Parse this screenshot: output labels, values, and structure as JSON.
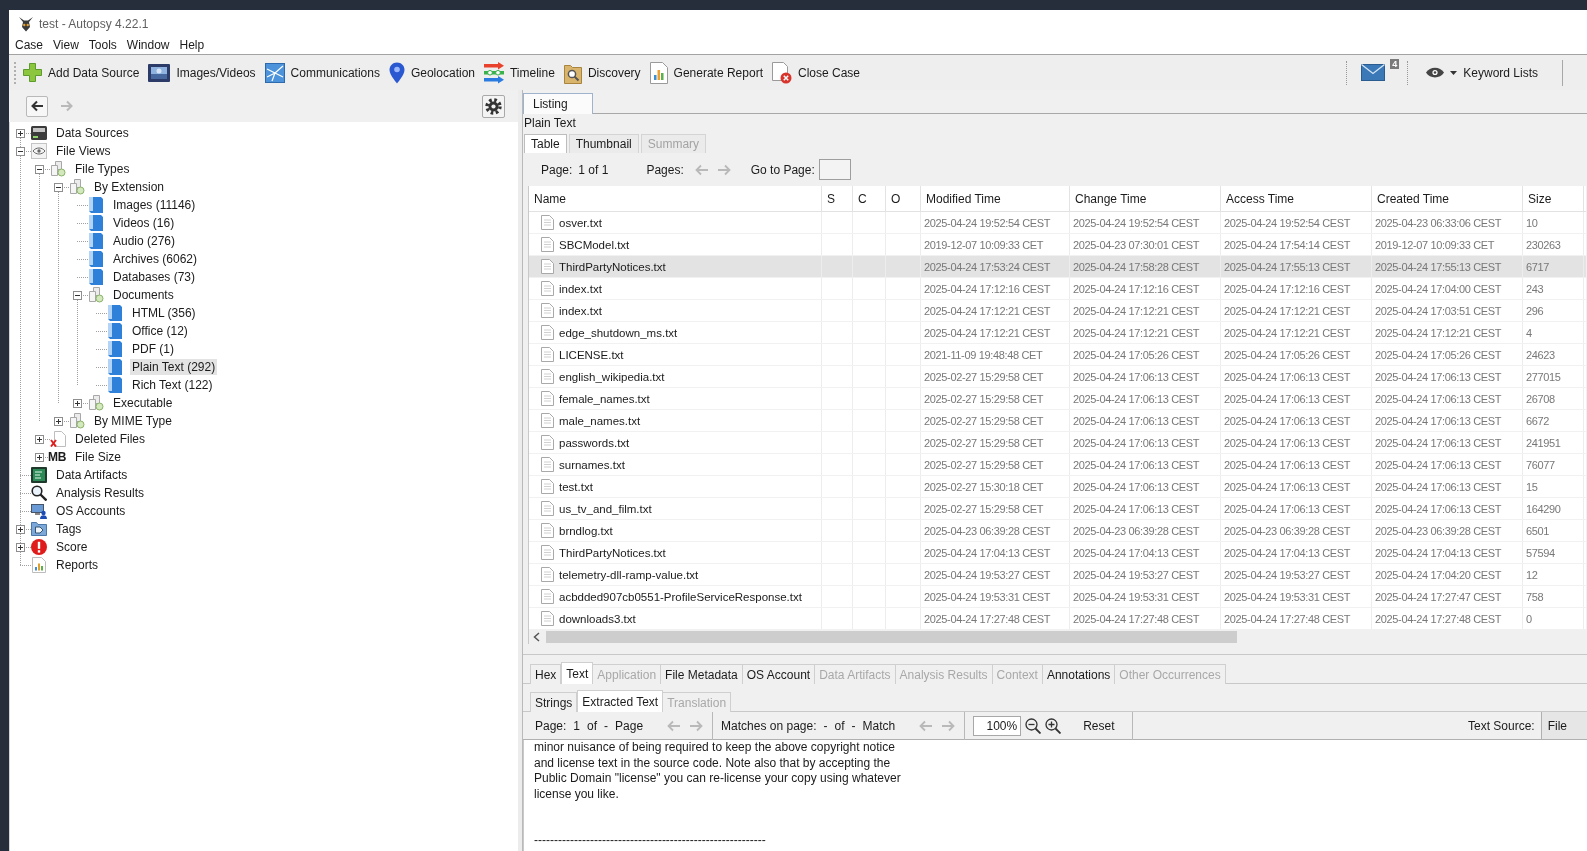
{
  "window": {
    "title": "test - Autopsy 4.22.1"
  },
  "menu": [
    "Case",
    "View",
    "Tools",
    "Window",
    "Help"
  ],
  "toolbar": {
    "buttons": [
      "Add Data Source",
      "Images/Videos",
      "Communications",
      "Geolocation",
      "Timeline",
      "Discovery",
      "Generate Report",
      "Close Case"
    ],
    "notification_count": "4",
    "keyword_lists": "Keyword Lists"
  },
  "navigation": {
    "buttons": [
      {
        "disabled": false
      },
      {
        "disabled": true
      }
    ]
  },
  "tree": [
    {
      "label": "Data Sources",
      "kind": "drive",
      "expanded": false,
      "selected": false
    },
    {
      "label": "File Views",
      "kind": "views",
      "expanded": true,
      "selected": false,
      "children": [
        {
          "label": "File Types",
          "kind": "group",
          "expanded": true,
          "selected": false,
          "children": [
            {
              "label": "By Extension",
              "kind": "group",
              "expanded": true,
              "selected": false,
              "children": [
                {
                  "label": "Images (11146)",
                  "kind": "filter",
                  "selected": false
                },
                {
                  "label": "Videos (16)",
                  "kind": "filter",
                  "selected": false
                },
                {
                  "label": "Audio (276)",
                  "kind": "filter",
                  "selected": false
                },
                {
                  "label": "Archives (6062)",
                  "kind": "filter",
                  "selected": false
                },
                {
                  "label": "Databases (73)",
                  "kind": "filter",
                  "selected": false
                },
                {
                  "label": "Documents",
                  "kind": "group",
                  "expanded": true,
                  "selected": false,
                  "children": [
                    {
                      "label": "HTML (356)",
                      "kind": "filter",
                      "selected": false
                    },
                    {
                      "label": "Office (12)",
                      "kind": "filter",
                      "selected": false
                    },
                    {
                      "label": "PDF (1)",
                      "kind": "filter",
                      "selected": false
                    },
                    {
                      "label": "Plain Text (292)",
                      "kind": "filter",
                      "selected": true
                    },
                    {
                      "label": "Rich Text (122)",
                      "kind": "filter",
                      "selected": false
                    }
                  ]
                },
                {
                  "label": "Executable",
                  "kind": "group",
                  "expanded": false,
                  "selected": false
                }
              ]
            },
            {
              "label": "By MIME Type",
              "kind": "group",
              "expanded": false,
              "selected": false
            }
          ]
        },
        {
          "label": "Deleted Files",
          "kind": "deleted",
          "expanded": false,
          "selected": false
        },
        {
          "label": "File Size",
          "kind": "size",
          "icon_text": "MB",
          "expanded": false,
          "selected": false
        }
      ]
    },
    {
      "label": "Data Artifacts",
      "kind": "artifacts",
      "selected": false
    },
    {
      "label": "Analysis Results",
      "kind": "results",
      "selected": false
    },
    {
      "label": "OS Accounts",
      "kind": "accounts",
      "selected": false
    },
    {
      "label": "Tags",
      "kind": "tags",
      "expanded": false,
      "selected": false
    },
    {
      "label": "Score",
      "kind": "score",
      "expanded": false,
      "selected": false
    },
    {
      "label": "Reports",
      "kind": "reports",
      "selected": false
    }
  ],
  "listing": {
    "tabs": [
      {
        "label": "Listing",
        "selected": true
      }
    ],
    "heading": "Plain Text",
    "view_tabs": [
      {
        "label": "Table",
        "selected": true,
        "disabled": false
      },
      {
        "label": "Thumbnail",
        "selected": false,
        "disabled": false
      },
      {
        "label": "Summary",
        "selected": false,
        "disabled": true
      }
    ],
    "paging": {
      "page_label": "Page:",
      "page_value": "1 of 1",
      "pages_label": "Pages:",
      "arrows": [
        {
          "disabled": true
        },
        {
          "disabled": true
        }
      ],
      "goto_label": "Go to Page:"
    },
    "table": {
      "columns": [
        "Name",
        "S",
        "C",
        "O",
        "Modified Time",
        "Change Time",
        "Access Time",
        "Created Time",
        "Size"
      ],
      "rows": [
        {
          "name": "osver.txt",
          "modified_time": "2025-04-24 19:52:54 CEST",
          "change_time": "2025-04-24 19:52:54 CEST",
          "access_time": "2025-04-24 19:52:54 CEST",
          "created_time": "2025-04-23 06:33:06 CEST",
          "size": "10",
          "selected": false
        },
        {
          "name": "SBCModel.txt",
          "modified_time": "2019-12-07 10:09:33 CET",
          "change_time": "2025-04-23 07:30:01 CEST",
          "access_time": "2025-04-24 17:54:14 CEST",
          "created_time": "2019-12-07 10:09:33 CET",
          "size": "230263",
          "selected": false
        },
        {
          "name": "ThirdPartyNotices.txt",
          "modified_time": "2025-04-24 17:53:24 CEST",
          "change_time": "2025-04-24 17:58:28 CEST",
          "access_time": "2025-04-24 17:55:13 CEST",
          "created_time": "2025-04-24 17:55:13 CEST",
          "size": "6717",
          "selected": true
        },
        {
          "name": "index.txt",
          "modified_time": "2025-04-24 17:12:16 CEST",
          "change_time": "2025-04-24 17:12:16 CEST",
          "access_time": "2025-04-24 17:12:16 CEST",
          "created_time": "2025-04-24 17:04:00 CEST",
          "size": "243",
          "selected": false
        },
        {
          "name": "index.txt",
          "modified_time": "2025-04-24 17:12:21 CEST",
          "change_time": "2025-04-24 17:12:21 CEST",
          "access_time": "2025-04-24 17:12:21 CEST",
          "created_time": "2025-04-24 17:03:51 CEST",
          "size": "296",
          "selected": false
        },
        {
          "name": "edge_shutdown_ms.txt",
          "modified_time": "2025-04-24 17:12:21 CEST",
          "change_time": "2025-04-24 17:12:21 CEST",
          "access_time": "2025-04-24 17:12:21 CEST",
          "created_time": "2025-04-24 17:12:21 CEST",
          "size": "4",
          "selected": false
        },
        {
          "name": "LICENSE.txt",
          "modified_time": "2021-11-09 19:48:48 CET",
          "change_time": "2025-04-24 17:05:26 CEST",
          "access_time": "2025-04-24 17:05:26 CEST",
          "created_time": "2025-04-24 17:05:26 CEST",
          "size": "24623",
          "selected": false
        },
        {
          "name": "english_wikipedia.txt",
          "modified_time": "2025-02-27 15:29:58 CET",
          "change_time": "2025-04-24 17:06:13 CEST",
          "access_time": "2025-04-24 17:06:13 CEST",
          "created_time": "2025-04-24 17:06:13 CEST",
          "size": "277015",
          "selected": false
        },
        {
          "name": "female_names.txt",
          "modified_time": "2025-02-27 15:29:58 CET",
          "change_time": "2025-04-24 17:06:13 CEST",
          "access_time": "2025-04-24 17:06:13 CEST",
          "created_time": "2025-04-24 17:06:13 CEST",
          "size": "26708",
          "selected": false
        },
        {
          "name": "male_names.txt",
          "modified_time": "2025-02-27 15:29:58 CET",
          "change_time": "2025-04-24 17:06:13 CEST",
          "access_time": "2025-04-24 17:06:13 CEST",
          "created_time": "2025-04-24 17:06:13 CEST",
          "size": "6672",
          "selected": false
        },
        {
          "name": "passwords.txt",
          "modified_time": "2025-02-27 15:29:58 CET",
          "change_time": "2025-04-24 17:06:13 CEST",
          "access_time": "2025-04-24 17:06:13 CEST",
          "created_time": "2025-04-24 17:06:13 CEST",
          "size": "241951",
          "selected": false
        },
        {
          "name": "surnames.txt",
          "modified_time": "2025-02-27 15:29:58 CET",
          "change_time": "2025-04-24 17:06:13 CEST",
          "access_time": "2025-04-24 17:06:13 CEST",
          "created_time": "2025-04-24 17:06:13 CEST",
          "size": "76077",
          "selected": false
        },
        {
          "name": "test.txt",
          "modified_time": "2025-02-27 15:30:18 CET",
          "change_time": "2025-04-24 17:06:13 CEST",
          "access_time": "2025-04-24 17:06:13 CEST",
          "created_time": "2025-04-24 17:06:13 CEST",
          "size": "15",
          "selected": false
        },
        {
          "name": "us_tv_and_film.txt",
          "modified_time": "2025-02-27 15:29:58 CET",
          "change_time": "2025-04-24 17:06:13 CEST",
          "access_time": "2025-04-24 17:06:13 CEST",
          "created_time": "2025-04-24 17:06:13 CEST",
          "size": "164290",
          "selected": false
        },
        {
          "name": "brndlog.txt",
          "modified_time": "2025-04-23 06:39:28 CEST",
          "change_time": "2025-04-23 06:39:28 CEST",
          "access_time": "2025-04-23 06:39:28 CEST",
          "created_time": "2025-04-23 06:39:28 CEST",
          "size": "6501",
          "selected": false
        },
        {
          "name": "ThirdPartyNotices.txt",
          "modified_time": "2025-04-24 17:04:13 CEST",
          "change_time": "2025-04-24 17:04:13 CEST",
          "access_time": "2025-04-24 17:04:13 CEST",
          "created_time": "2025-04-24 17:04:13 CEST",
          "size": "57594",
          "selected": false
        },
        {
          "name": "telemetry-dll-ramp-value.txt",
          "modified_time": "2025-04-24 19:53:27 CEST",
          "change_time": "2025-04-24 19:53:27 CEST",
          "access_time": "2025-04-24 19:53:27 CEST",
          "created_time": "2025-04-24 17:04:20 CEST",
          "size": "12",
          "selected": false
        },
        {
          "name": "acbdded907cb0551-ProfileServiceResponse.txt",
          "modified_time": "2025-04-24 19:53:31 CEST",
          "change_time": "2025-04-24 19:53:31 CEST",
          "access_time": "2025-04-24 19:53:31 CEST",
          "created_time": "2025-04-24 17:27:47 CEST",
          "size": "758",
          "selected": false
        },
        {
          "name": "downloads3.txt",
          "modified_time": "2025-04-24 17:27:48 CEST",
          "change_time": "2025-04-24 17:27:48 CEST",
          "access_time": "2025-04-24 17:27:48 CEST",
          "created_time": "2025-04-24 17:27:48 CEST",
          "size": "0",
          "selected": false
        }
      ]
    }
  },
  "content_viewer": {
    "tabs": [
      {
        "label": "Hex",
        "selected": false,
        "disabled": false
      },
      {
        "label": "Text",
        "selected": true,
        "disabled": false
      },
      {
        "label": "Application",
        "selected": false,
        "disabled": true
      },
      {
        "label": "File Metadata",
        "selected": false,
        "disabled": false
      },
      {
        "label": "OS Account",
        "selected": false,
        "disabled": false
      },
      {
        "label": "Data Artifacts",
        "selected": false,
        "disabled": true
      },
      {
        "label": "Analysis Results",
        "selected": false,
        "disabled": true
      },
      {
        "label": "Context",
        "selected": false,
        "disabled": true
      },
      {
        "label": "Annotations",
        "selected": false,
        "disabled": false
      },
      {
        "label": "Other Occurrences",
        "selected": false,
        "disabled": true
      }
    ],
    "sub_tabs": [
      {
        "label": "Strings",
        "selected": false,
        "disabled": false
      },
      {
        "label": "Extracted Text",
        "selected": true,
        "disabled": false
      },
      {
        "label": "Translation",
        "selected": false,
        "disabled": true
      }
    ],
    "toolbar": {
      "page_parts": [
        "Page:",
        "1",
        "of",
        "-",
        "Page"
      ],
      "page_arrows": [
        {
          "disabled": true
        },
        {
          "disabled": true
        }
      ],
      "match_parts": [
        "Matches on page:",
        "-",
        "of",
        "-",
        "Match"
      ],
      "match_arrows": [
        {
          "disabled": true
        },
        {
          "disabled": true
        }
      ],
      "zoom": "100%",
      "reset": "Reset",
      "source_label": "Text Source:",
      "source_value": "File"
    },
    "text": {
      "lines": [
        "minor nuisance of being required to keep the above copyright notice",
        "and license text in the source code. Note also that by accepting the",
        "Public Domain \"license\" you can re-license your copy using whatever",
        "license you like."
      ],
      "rule": "----------------------------------------------------------"
    }
  }
}
